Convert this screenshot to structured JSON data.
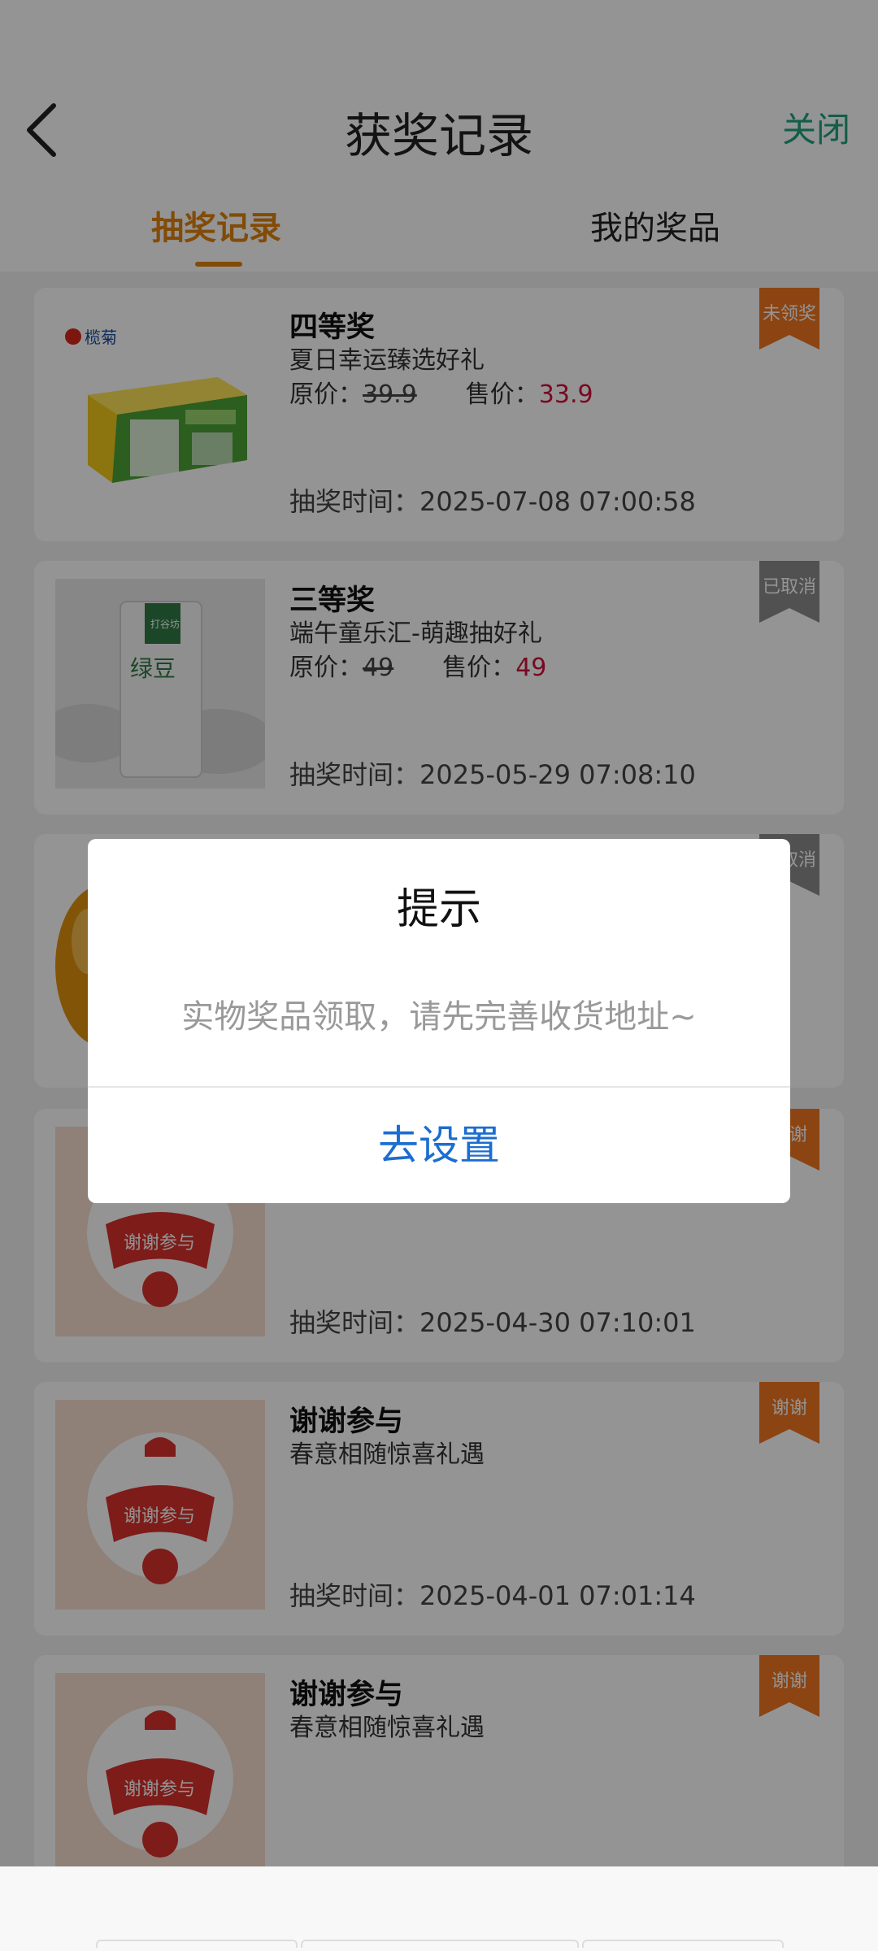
{
  "header": {
    "title": "获奖记录",
    "close_label": "关闭"
  },
  "tabs": [
    {
      "label": "抽奖记录",
      "active": true
    },
    {
      "label": "我的奖品",
      "active": false
    }
  ],
  "records": [
    {
      "level": "四等奖",
      "activity": "夏日幸运臻选好礼",
      "orig_label": "原价：",
      "orig_price": "39.9",
      "sale_label": "售价：",
      "sale_price": "33.9",
      "time_label": "抽奖时间：",
      "time": "2025-07-08 07:00:58",
      "status": "未领奖",
      "status_color": "#f0751f",
      "image": "mosquito-liquid-product-icon",
      "brand_logo": "榄菊"
    },
    {
      "level": "三等奖",
      "activity": "端午童乐汇-萌趣抽好礼",
      "orig_label": "原价：",
      "orig_price": "49",
      "sale_label": "售价：",
      "sale_price": "49",
      "time_label": "抽奖时间：",
      "time": "2025-05-29 07:08:10",
      "status": "已取消",
      "status_color": "#8c8c8c",
      "image": "mung-bean-bag-product-icon",
      "package_text_top": "打谷坊",
      "package_text_main": "绿豆"
    },
    {
      "status": "已取消",
      "status_color": "#8c8c8c",
      "image": "orange-product-icon"
    },
    {
      "time_label": "抽奖时间：",
      "time": "2025-04-30 07:10:01",
      "status": "谢谢",
      "status_color": "#f0751f",
      "image": "thanks-for-participating-icon",
      "badge_text": "谢谢参与"
    },
    {
      "level": "谢谢参与",
      "activity": "春意相随惊喜礼遇",
      "time_label": "抽奖时间：",
      "time": "2025-04-01 07:01:14",
      "status": "谢谢",
      "status_color": "#f0751f",
      "image": "thanks-for-participating-icon",
      "badge_text": "谢谢参与"
    },
    {
      "level": "谢谢参与",
      "activity": "春意相随惊喜礼遇",
      "status": "谢谢",
      "status_color": "#f0751f",
      "image": "thanks-for-participating-icon",
      "badge_text": "谢谢参与"
    }
  ],
  "dialog": {
    "title": "提示",
    "message": "实物奖品领取，请先完善收货地址~",
    "button": "去设置"
  },
  "colors": {
    "accent": "#e0820e",
    "close": "#1fa37f",
    "price": "#d0103a",
    "dialog_button": "#1c6dd0"
  }
}
